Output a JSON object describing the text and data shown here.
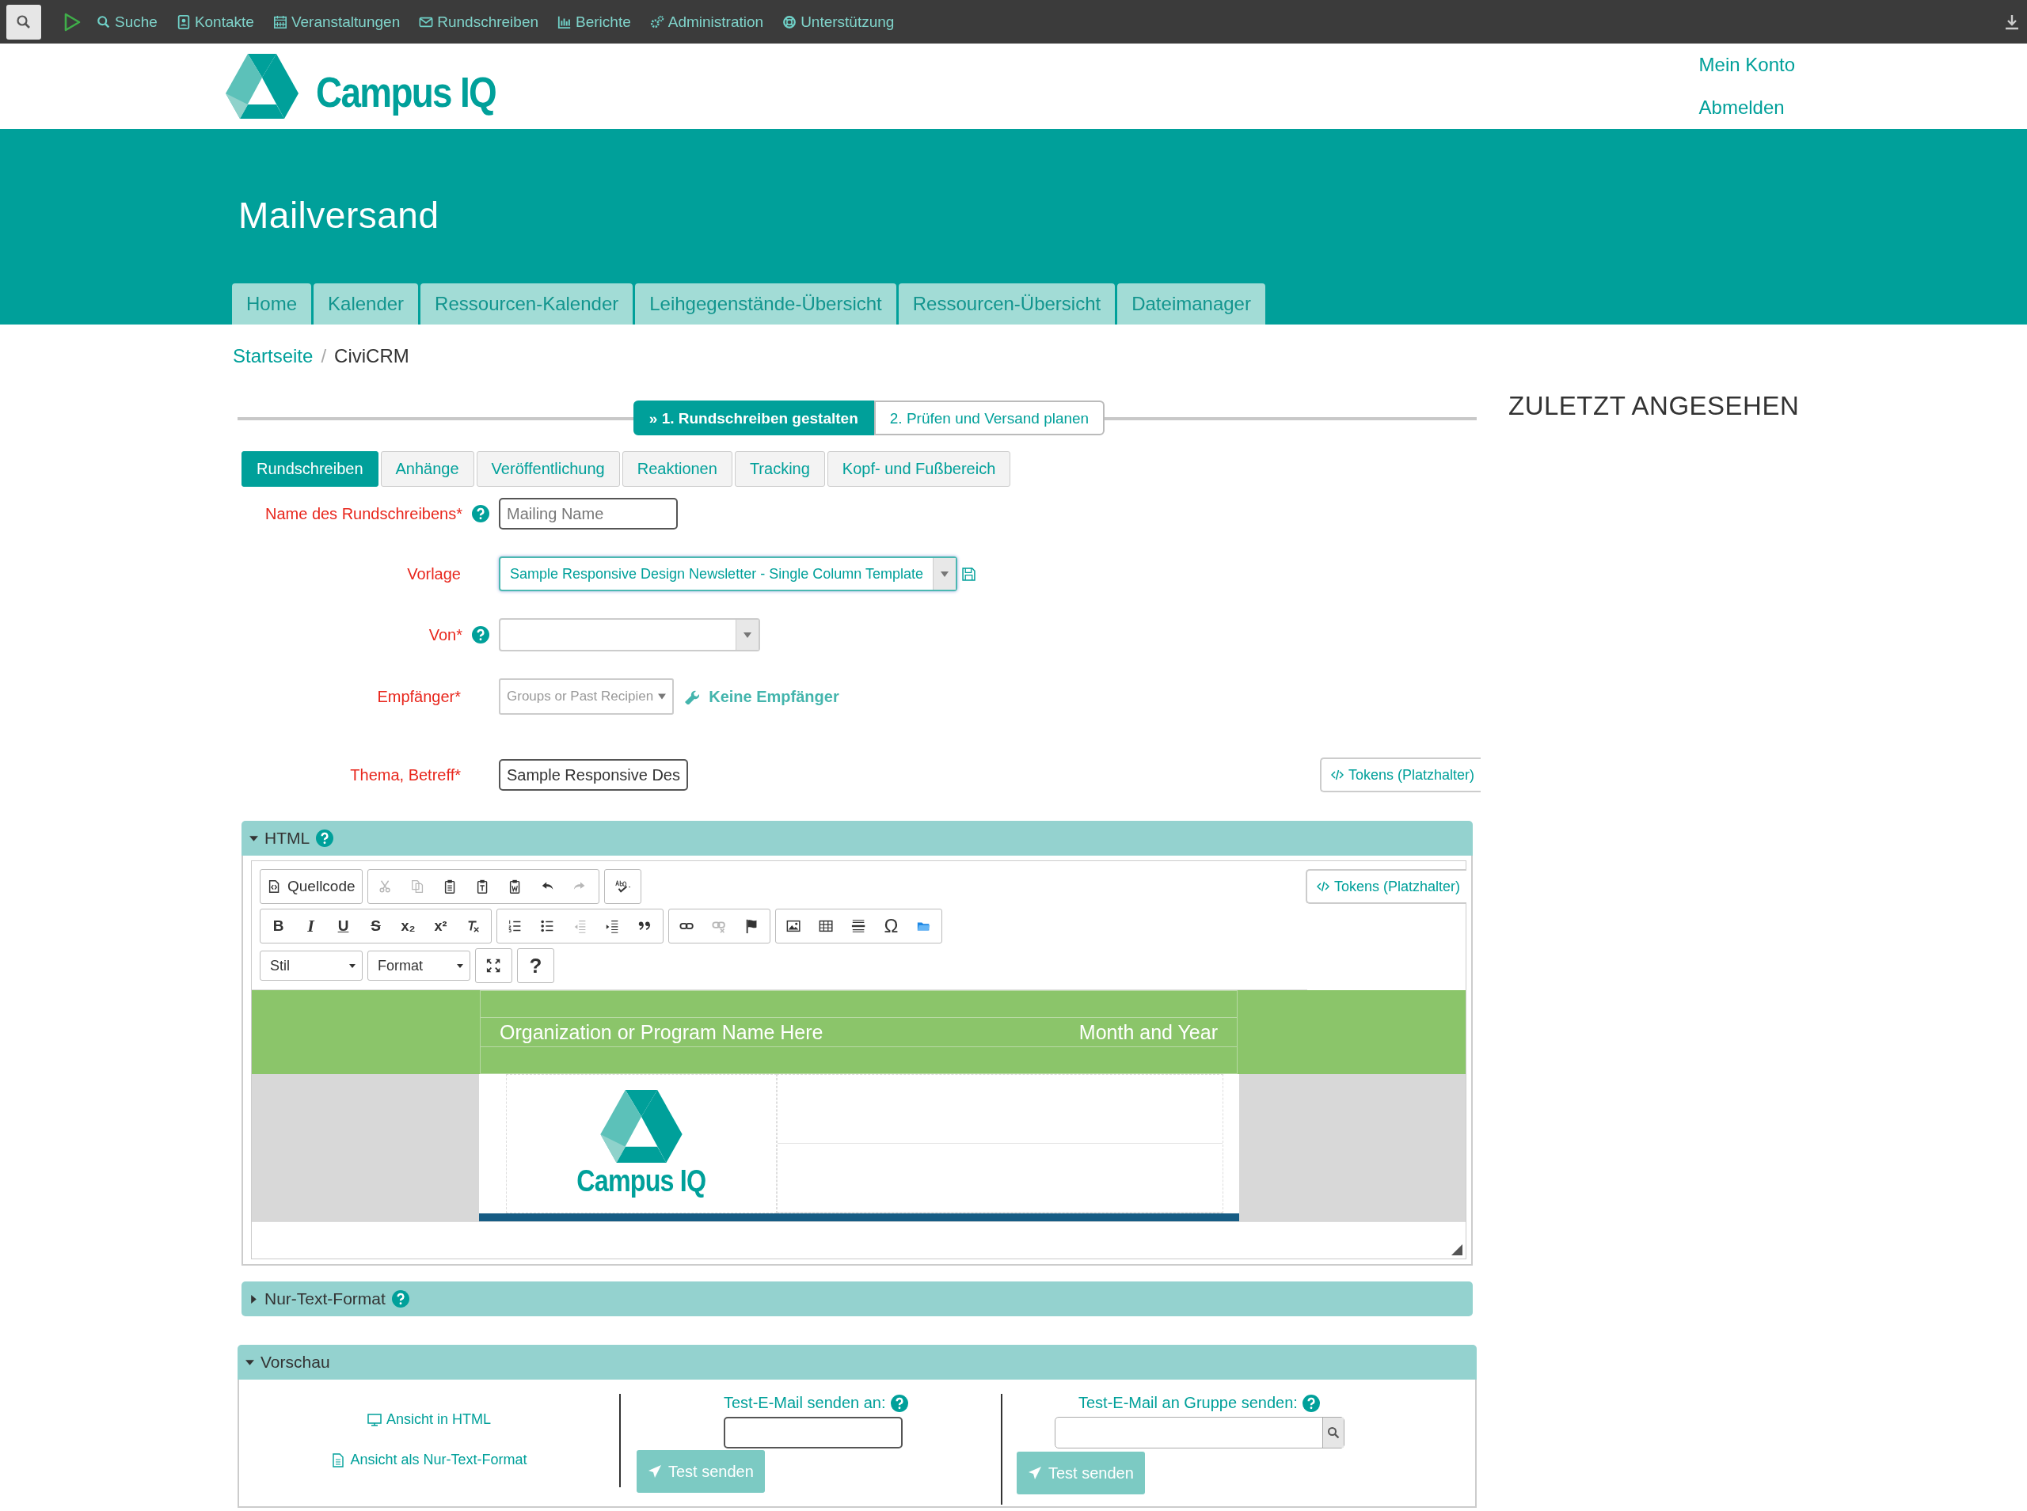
{
  "topbar": {
    "items": [
      {
        "kind": "search",
        "label": "Suche"
      },
      {
        "kind": "contact",
        "label": "Kontakte"
      },
      {
        "kind": "calendar",
        "label": "Veranstaltungen"
      },
      {
        "kind": "mail",
        "label": "Rundschreiben"
      },
      {
        "kind": "chart",
        "label": "Berichte"
      },
      {
        "kind": "gears",
        "label": "Administration"
      },
      {
        "kind": "lifebuoy",
        "label": "Unterstützung"
      }
    ]
  },
  "header": {
    "logo": "Campus IQ",
    "account_links": [
      "Mein Konto",
      "Abmelden"
    ]
  },
  "banner": {
    "title": "Mailversand",
    "nav": [
      "Home",
      "Kalender",
      "Ressourcen-Kalender",
      "Leihgegenstände-Übersicht",
      "Ressourcen-Übersicht",
      "Dateimanager"
    ]
  },
  "breadcrumb": {
    "items": [
      "Startseite",
      "CiviCRM"
    ],
    "separator": "/"
  },
  "wizard": {
    "steps": [
      {
        "label": "» 1. Rundschreiben gestalten",
        "selected": true
      },
      {
        "label": "2. Prüfen und Versand planen",
        "selected": false
      }
    ]
  },
  "form_tabs": [
    {
      "label": "Rundschreiben",
      "selected": true
    },
    {
      "label": "Anhänge",
      "selected": false
    },
    {
      "label": "Veröffentlichung",
      "selected": false
    },
    {
      "label": "Reaktionen",
      "selected": false
    },
    {
      "label": "Tracking",
      "selected": false
    },
    {
      "label": "Kopf- und Fußbereich",
      "selected": false
    }
  ],
  "form": {
    "fields": [
      {
        "kind": "text",
        "label": "Name des Rundschreibens*",
        "help": true,
        "placeholder": "Mailing Name"
      },
      {
        "kind": "template",
        "label": "Vorlage",
        "help": false,
        "value": "Sample Responsive Design Newsletter - Single Column Template"
      },
      {
        "kind": "select",
        "label": "Von*",
        "help": true
      },
      {
        "kind": "recipients",
        "label": "Empfänger*",
        "help": false,
        "placeholder": "Groups or Past Recipien",
        "link": "Keine Empfänger"
      },
      {
        "kind": "subject",
        "label": "Thema, Betreff*",
        "help": false,
        "value": "Sample Responsive Des",
        "tokens": "Tokens (Platzhalter)"
      }
    ]
  },
  "html_section": {
    "title": "HTML",
    "expanded": true,
    "help": true,
    "tokens": "Tokens (Platzhalter)",
    "toolbar": [
      [
        [
          {
            "kind": "source",
            "text": "Quellcode",
            "disabled": false
          }
        ],
        [
          {
            "kind": "cut",
            "disabled": true
          },
          {
            "kind": "copy",
            "disabled": true
          },
          {
            "kind": "paste",
            "disabled": false
          },
          {
            "kind": "paste-text",
            "disabled": false
          },
          {
            "kind": "paste-word",
            "disabled": false
          },
          {
            "kind": "undo",
            "disabled": false
          },
          {
            "kind": "redo",
            "disabled": true
          }
        ],
        [
          {
            "kind": "spellcheck",
            "disabled": false
          }
        ]
      ],
      [
        [
          {
            "kind": "bold",
            "text": "B",
            "disabled": false
          },
          {
            "kind": "italic",
            "text": "I",
            "disabled": false
          },
          {
            "kind": "underline",
            "text": "U",
            "disabled": false
          },
          {
            "kind": "strike",
            "text": "S",
            "disabled": false
          },
          {
            "kind": "sub",
            "text": "x₂",
            "disabled": false
          },
          {
            "kind": "sup",
            "text": "x²",
            "disabled": false
          },
          {
            "kind": "clear",
            "disabled": false
          }
        ],
        [
          {
            "kind": "ol",
            "disabled": false
          },
          {
            "kind": "ul",
            "disabled": false
          },
          {
            "kind": "outdent",
            "disabled": true
          },
          {
            "kind": "indent",
            "disabled": false
          },
          {
            "kind": "quote",
            "disabled": false
          }
        ],
        [
          {
            "kind": "link",
            "disabled": false
          },
          {
            "kind": "unlink",
            "disabled": true
          },
          {
            "kind": "anchor",
            "disabled": false
          }
        ],
        [
          {
            "kind": "image",
            "disabled": false
          },
          {
            "kind": "table",
            "disabled": false
          },
          {
            "kind": "hr",
            "disabled": false
          },
          {
            "kind": "omega",
            "text": "Ω",
            "disabled": false
          },
          {
            "kind": "folder",
            "disabled": false
          }
        ]
      ]
    ],
    "dropdowns": [
      "Stil",
      "Format"
    ],
    "extra_buttons": [
      {
        "kind": "maximize",
        "disabled": false
      },
      {
        "kind": "help",
        "text": "?",
        "disabled": false
      }
    ],
    "content": {
      "org_name": "Organization or Program Name Here",
      "date": "Month and Year",
      "logo": "Campus IQ"
    }
  },
  "text_section": {
    "title": "Nur-Text-Format",
    "expanded": false,
    "help": true
  },
  "preview_section": {
    "title": "Vorschau",
    "expanded": true,
    "links": [
      {
        "kind": "html",
        "label": "Ansicht in HTML"
      },
      {
        "kind": "text",
        "label": "Ansicht als Nur-Text-Format"
      }
    ],
    "test_email": {
      "label": "Test-E-Mail senden an:",
      "help": true,
      "button": "Test senden"
    },
    "test_group": {
      "label": "Test-E-Mail an Gruppe senden:",
      "help": true,
      "button": "Test senden"
    }
  },
  "sidebar": {
    "title": "ZULETZT ANGESEHEN"
  }
}
